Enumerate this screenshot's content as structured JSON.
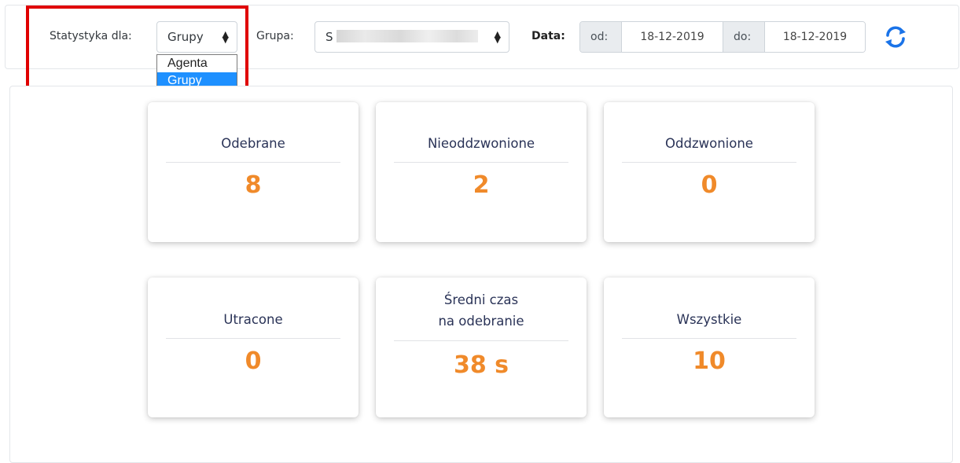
{
  "filters": {
    "stat_label": "Statystyka dla:",
    "stat_select_value": "Grupy",
    "stat_options": [
      "Agenta",
      "Grupy"
    ],
    "group_label": "Grupa:",
    "group_select_value": "S",
    "date_label": "Data:",
    "from_label": "od:",
    "from_value": "18-12-2019",
    "to_label": "do:",
    "to_value": "18-12-2019"
  },
  "stats": [
    {
      "title": "Odebrane",
      "value": "8"
    },
    {
      "title": "Nieoddzwonione",
      "value": "2"
    },
    {
      "title": "Oddzwonione",
      "value": "0"
    },
    {
      "title": "Utracone",
      "value": "0"
    },
    {
      "title_line1": "Średni czas",
      "title_line2": "na odebranie",
      "value": "38 s"
    },
    {
      "title": "Wszystkie",
      "value": "10"
    }
  ],
  "colors": {
    "accent_value": "#f08a2a",
    "title_text": "#2a3357",
    "highlight_box": "#e00000",
    "selected_option": "#1e90ff",
    "refresh_icon": "#1a73e8"
  },
  "icons": {
    "refresh": "refresh-icon"
  }
}
